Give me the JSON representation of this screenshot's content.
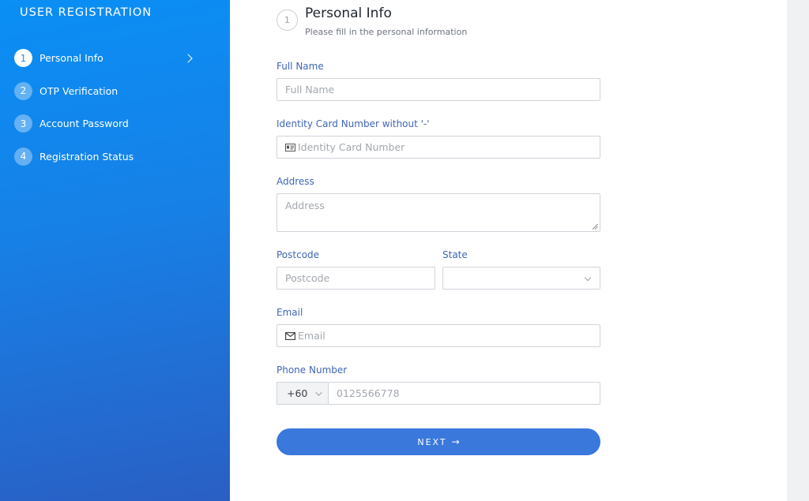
{
  "sidebar": {
    "title": "USER REGISTRATION",
    "steps": [
      {
        "num": "1",
        "label": "Personal Info",
        "active": true
      },
      {
        "num": "2",
        "label": "OTP Verification"
      },
      {
        "num": "3",
        "label": "Account Password"
      },
      {
        "num": "4",
        "label": "Registration Status"
      }
    ]
  },
  "header": {
    "step_num": "1",
    "title": "Personal Info",
    "subtitle": "Please fill in the personal information"
  },
  "form": {
    "full_name": {
      "label": "Full Name",
      "placeholder": "Full Name",
      "value": ""
    },
    "ic": {
      "label": "Identity Card Number without '-'",
      "placeholder": "Identity Card Number",
      "value": "",
      "icon": "id-card-icon"
    },
    "address": {
      "label": "Address",
      "placeholder": "Address",
      "value": ""
    },
    "postcode": {
      "label": "Postcode",
      "placeholder": "Postcode",
      "value": ""
    },
    "state": {
      "label": "State",
      "selected": ""
    },
    "email": {
      "label": "Email",
      "placeholder": "Email",
      "value": "",
      "icon": "envelope-icon"
    },
    "phone": {
      "label": "Phone Number",
      "country_code": "+60",
      "placeholder": "0125566778",
      "value": ""
    }
  },
  "buttons": {
    "next_label": "NEXT",
    "next_arrow": "→"
  },
  "colors": {
    "accent": "#3a78db",
    "sidebar_top": "#0a8ff5",
    "sidebar_bottom": "#2a5fc4",
    "label": "#3f66b5"
  }
}
